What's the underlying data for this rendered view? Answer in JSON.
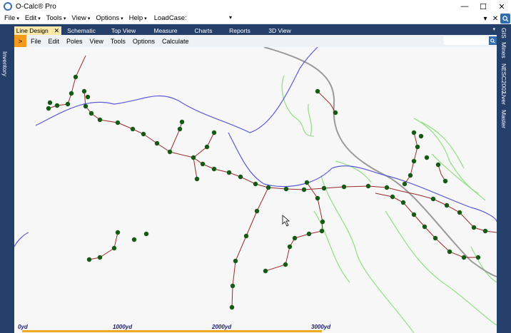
{
  "window": {
    "title": "O-Calc® Pro",
    "minimize": "—",
    "maximize": "☐",
    "close": "✕"
  },
  "menu": {
    "items": [
      {
        "label": "File"
      },
      {
        "label": "Edit"
      },
      {
        "label": "Tools"
      },
      {
        "label": "View"
      },
      {
        "label": "Options"
      },
      {
        "label": "Help"
      }
    ],
    "loadcase_label": "LoadCase:",
    "loadcase_value": "",
    "dropdown_caret": "▾",
    "search_icon": "search-icon"
  },
  "left_rail": {
    "label": "Inventory"
  },
  "right_rail": {
    "labels": [
      "GIS",
      "Mines",
      "NESC2002",
      "Uver",
      "Master"
    ]
  },
  "tabs": [
    {
      "label": "Line Design",
      "active": true,
      "close": "✕"
    },
    {
      "label": "Schematic"
    },
    {
      "label": "Top View"
    },
    {
      "label": "Measure"
    },
    {
      "label": "Charts"
    },
    {
      "label": "Reports"
    },
    {
      "label": "3D View"
    }
  ],
  "subtoolbar": {
    "arrow": ">",
    "items": [
      {
        "label": "File"
      },
      {
        "label": "Edit"
      },
      {
        "label": "Poles"
      },
      {
        "label": "View"
      },
      {
        "label": "Tools"
      },
      {
        "label": "Options"
      },
      {
        "label": "Calculate"
      }
    ]
  },
  "scale": {
    "labels": [
      "0yd",
      "1000yd",
      "2000yd",
      "3000yd"
    ]
  },
  "colors": {
    "frame": "#253f6b",
    "accent": "#f59b1c",
    "pole": "#145a14",
    "span": "#9b2a2a",
    "water": "#5b5bd8",
    "road": "#9a9a9a",
    "contour": "#98e08a"
  }
}
